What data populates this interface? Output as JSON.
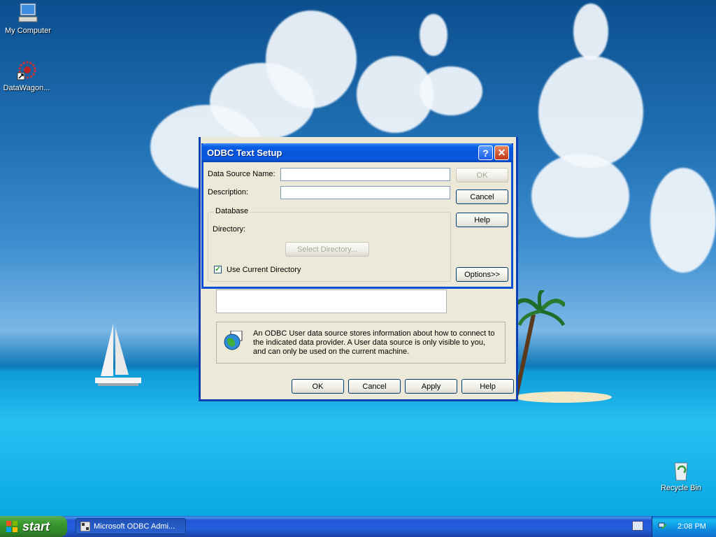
{
  "desktop": {
    "icons": [
      {
        "label": "My Computer"
      },
      {
        "label": "DataWagon..."
      },
      {
        "label": "Recycle Bin"
      }
    ]
  },
  "back_dialog": {
    "info_text": "An ODBC User data source stores information about how to connect to the indicated data provider.   A User data source is only visible to you, and can only be used on the current machine.",
    "buttons": {
      "ok": "OK",
      "cancel": "Cancel",
      "apply": "Apply",
      "help": "Help"
    }
  },
  "setup_dialog": {
    "title": "ODBC Text Setup",
    "title_help": "?",
    "title_close": "✕",
    "data_source_name_label": "Data Source Name:",
    "data_source_name_value": "",
    "description_label": "Description:",
    "description_value": "",
    "database_group": "Database",
    "directory_label": "Directory:",
    "select_directory": "Select Directory...",
    "use_current_directory": "Use Current Directory",
    "use_current_directory_checked": true,
    "buttons": {
      "ok": "OK",
      "cancel": "Cancel",
      "help": "Help",
      "options": "Options>>"
    }
  },
  "taskbar": {
    "start": "start",
    "task_item": "Microsoft ODBC Admi...",
    "clock": "2:08 PM"
  }
}
